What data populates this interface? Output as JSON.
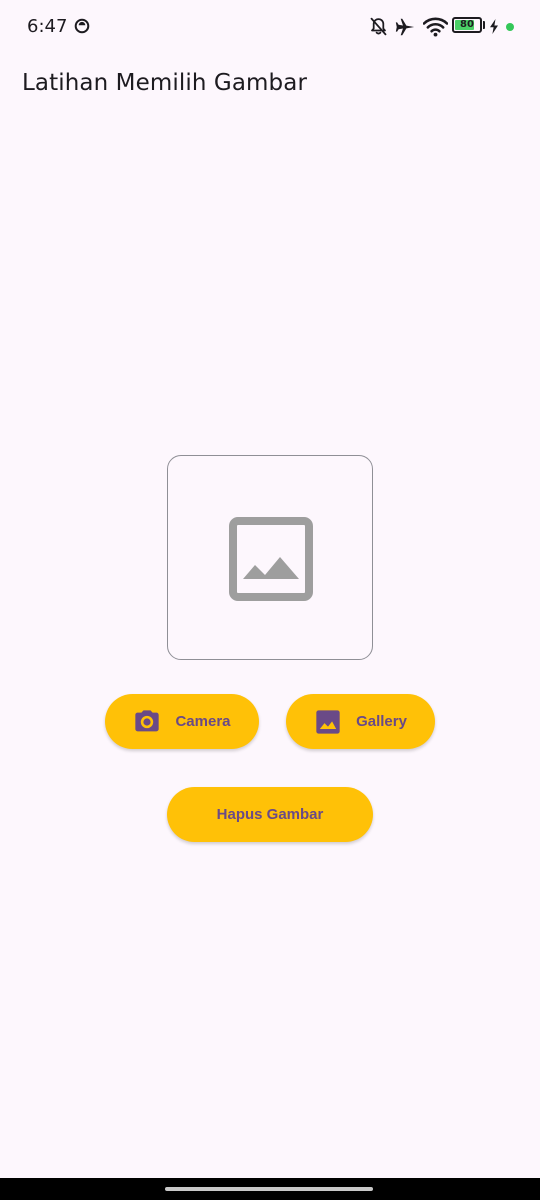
{
  "status_bar": {
    "time": "6:47",
    "battery_level": "80",
    "battery_fill_fraction": 0.8,
    "icons": [
      "whatsapp-icon",
      "bell-off-icon",
      "airplane-icon",
      "wifi-icon",
      "battery-icon",
      "charging-icon",
      "status-dot-icon"
    ],
    "accent_dot_color": "#34c759"
  },
  "app_bar": {
    "title": "Latihan Memilih Gambar"
  },
  "image_preview": {
    "placeholder_icon": "image-placeholder-icon"
  },
  "buttons": {
    "camera_label": "Camera",
    "gallery_label": "Gallery",
    "delete_label": "Hapus Gambar"
  },
  "colors": {
    "background": "#fdf7fd",
    "button_background": "#ffc107",
    "button_text": "#6a4a87",
    "placeholder_icon": "#9e9e9e"
  }
}
